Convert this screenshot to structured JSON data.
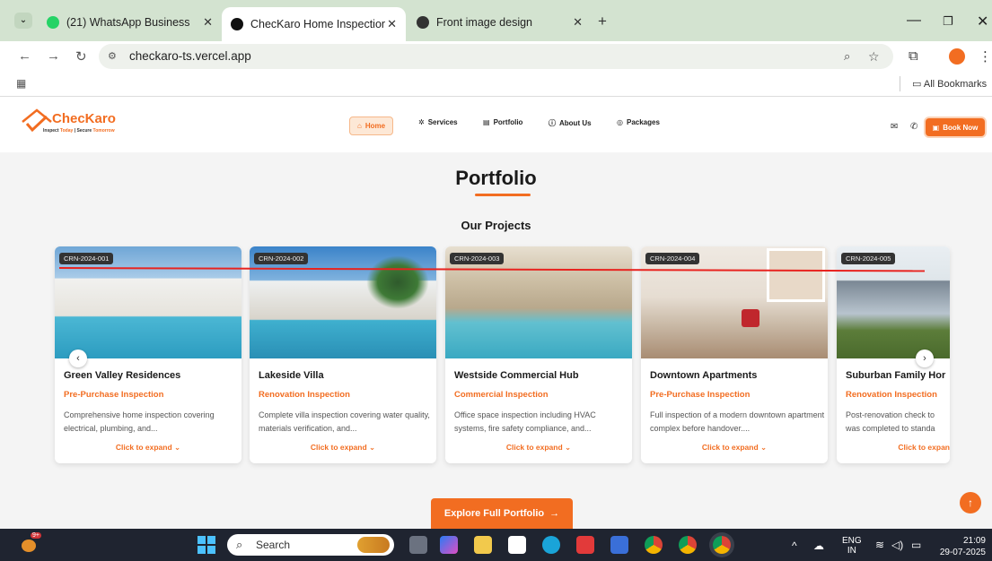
{
  "browser": {
    "tabs": [
      {
        "title": "(21) WhatsApp Business",
        "icon": "whatsapp-icon"
      },
      {
        "title": "ChecKaro Home Inspection - In",
        "icon": "vercel-icon"
      },
      {
        "title": "Front image design",
        "icon": "chatgpt-icon"
      }
    ],
    "url": "checkaro-ts.vercel.app",
    "all_bookmarks": "All Bookmarks"
  },
  "site": {
    "logo_name": "ChecKaro",
    "logo_tagline_1": "Inspect",
    "logo_tagline_2": "Today",
    "logo_tagline_3": "| Secure",
    "logo_tagline_4": "Tomorrow",
    "nav": [
      "Home",
      "Services",
      "Portfolio",
      "About Us",
      "Packages"
    ],
    "book_now": "Book Now"
  },
  "main": {
    "title": "Portfolio",
    "subtitle": "Our Projects",
    "cards": [
      {
        "crn": "CRN-2024-001",
        "title": "Green Valley Residences",
        "category": "Pre-Purchase Inspection",
        "desc": "Comprehensive home inspection covering electrical, plumbing, and...",
        "expand": "Click to expand"
      },
      {
        "crn": "CRN-2024-002",
        "title": "Lakeside Villa",
        "category": "Renovation Inspection",
        "desc": "Complete villa inspection covering water quality, materials verification, and...",
        "expand": "Click to expand"
      },
      {
        "crn": "CRN-2024-003",
        "title": "Westside Commercial Hub",
        "category": "Commercial Inspection",
        "desc": "Office space inspection including HVAC systems, fire safety compliance, and...",
        "expand": "Click to expand"
      },
      {
        "crn": "CRN-2024-004",
        "title": "Downtown Apartments",
        "category": "Pre-Purchase Inspection",
        "desc": "Full inspection of a modern downtown apartment complex before handover....",
        "expand": "Click to expand"
      },
      {
        "crn": "CRN-2024-005",
        "title": "Suburban Family Hor",
        "category": "Renovation Inspection",
        "desc": "Post-renovation check to was completed to standa",
        "expand": "Click to expan"
      }
    ],
    "explore_button": "Explore Full Portfolio"
  },
  "taskbar": {
    "search": "Search",
    "lang_1": "ENG",
    "lang_2": "IN",
    "time": "21:09",
    "date": "29-07-2025",
    "badge": "9+"
  },
  "colors": {
    "accent": "#f26d21",
    "annotation_line": "#e8231f"
  }
}
